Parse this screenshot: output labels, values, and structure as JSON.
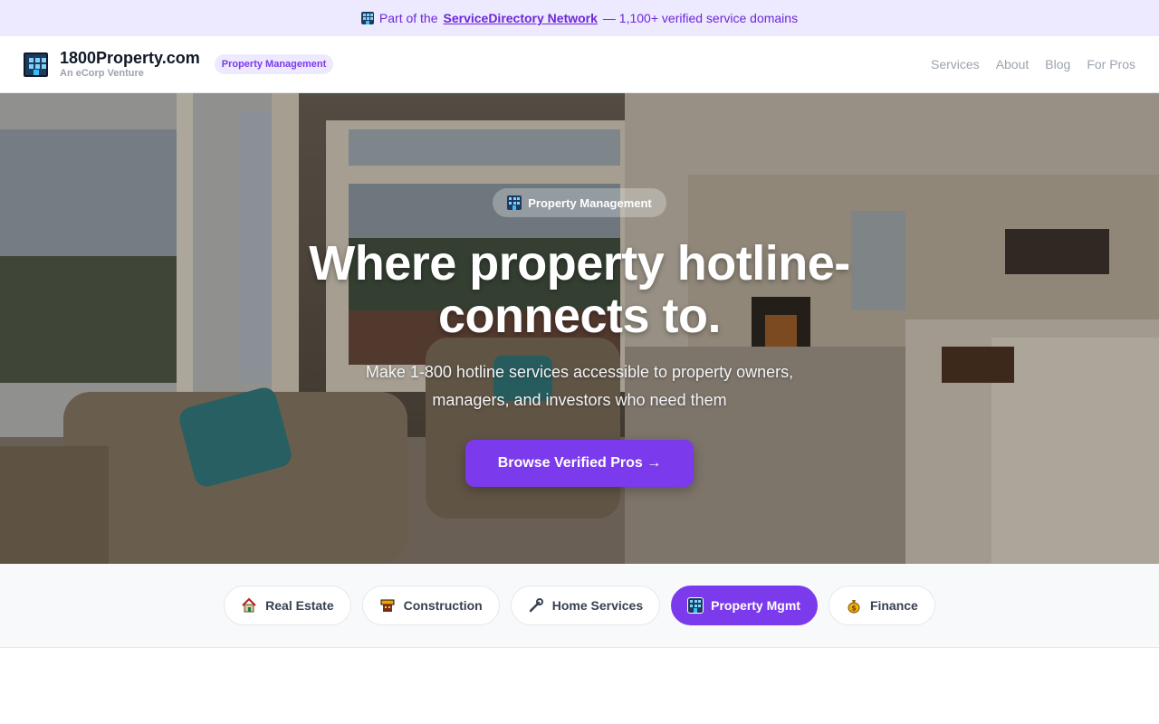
{
  "banner": {
    "prefix": "Part of the",
    "link": "ServiceDirectory Network",
    "suffix": "— 1,100+ verified service domains",
    "icon": "building-icon"
  },
  "header": {
    "brand_name": "1800Property.com",
    "brand_sub": "An eCorp Venture",
    "tag": "Property Management",
    "nav": [
      "Services",
      "About",
      "Blog",
      "For Pros"
    ]
  },
  "hero": {
    "pill": "Property Management",
    "headline": "Where property hotline-connects to.",
    "subtext": "Make 1-800 hotline services accessible to property owners, managers, and investors who need them",
    "cta": "Browse Verified Pros →"
  },
  "categories": [
    {
      "label": "Real Estate",
      "icon": "house-icon",
      "active": false
    },
    {
      "label": "Construction",
      "icon": "construction-icon",
      "active": false
    },
    {
      "label": "Home Services",
      "icon": "wrench-icon",
      "active": false
    },
    {
      "label": "Property Mgmt",
      "icon": "building-icon",
      "active": true
    },
    {
      "label": "Finance",
      "icon": "money-bag-icon",
      "active": false
    }
  ],
  "colors": {
    "accent": "#7c3aed",
    "banner_bg": "#ede9fe"
  }
}
